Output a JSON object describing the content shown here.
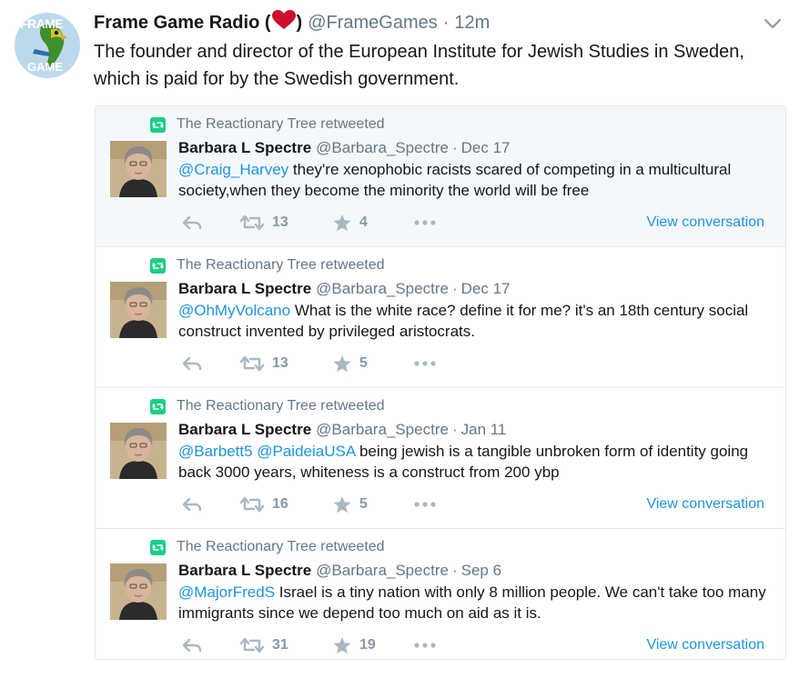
{
  "tweet": {
    "author_name": "Frame Game Radio (",
    "author_name_close": ")",
    "handle": "@FrameGames",
    "dot": "·",
    "time": "12m",
    "text": "The founder and director of the European Institute for Jewish Studies in Sweden, which is paid for by the Swedish government.",
    "avatar_text_top": "FRAME",
    "avatar_text_bottom": "GAME"
  },
  "colors": {
    "accent": "#1b95e0",
    "retweet_green": "#19cf86",
    "muted": "#657786",
    "heart": "#cc0d2c",
    "highlight_bg": "#f5f8fa",
    "border": "#e1e8ed"
  },
  "embedded": {
    "retweeted_by": "The Reactionary Tree retweeted",
    "view_conversation": "View conversation",
    "sep": "·",
    "cards": [
      {
        "name": "Barbara L Spectre",
        "handle": "@Barbara_Spectre",
        "date": "Dec 17",
        "mentions": "@Craig_Harvey",
        "text": " they're xenophobic racists scared of competing in a multicultural society,when they become the minority the world will be free",
        "retweets": "13",
        "likes": "4"
      },
      {
        "name": "Barbara L Spectre",
        "handle": "@Barbara_Spectre",
        "date": "Dec 17",
        "mentions": "@OhMyVolcano",
        "text": " What is the white race? define it for me? it's an 18th century social construct invented by privileged aristocrats.",
        "retweets": "13",
        "likes": "5"
      },
      {
        "name": "Barbara L Spectre",
        "handle": "@Barbara_Spectre",
        "date": "Jan 11",
        "mentions": "@Barbett5 @PaideiaUSA",
        "text": " being jewish is a tangible unbroken form of identity going back 3000 years, whiteness is a construct from 200 ybp",
        "retweets": "16",
        "likes": "5"
      },
      {
        "name": "Barbara L Spectre",
        "handle": "@Barbara_Spectre",
        "date": "Sep 6",
        "mentions": "@MajorFredS",
        "text": " Israel is a tiny nation with only 8 million people. We can't take too many immigrants since we depend too much on aid as it is.",
        "retweets": "31",
        "likes": "19"
      }
    ]
  }
}
